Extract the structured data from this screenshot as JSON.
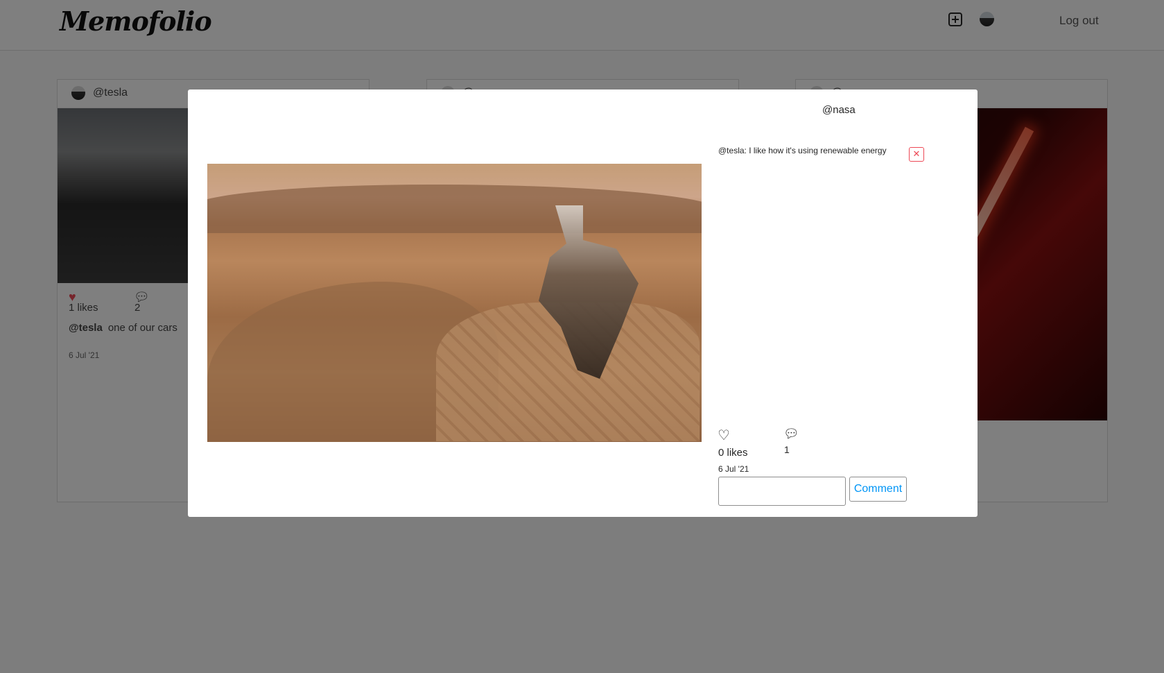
{
  "header": {
    "logo": "Memofolio",
    "logout_label": "Log out",
    "icons": {
      "add": "plus-square-icon",
      "profile": "avatar"
    }
  },
  "feed": [
    {
      "username": "@tesla",
      "likes": "1 likes",
      "comments": "2",
      "caption_user": "@tesla",
      "caption_text": "one of our cars",
      "date": "6 Jul '21",
      "liked": true
    },
    {
      "username": "@"
    },
    {
      "username": "@"
    }
  ],
  "modal": {
    "username": "@nasa",
    "comments": [
      {
        "text": "@tesla: I like how it's using renewable energy"
      }
    ],
    "likes": "0 likes",
    "comment_count": "1",
    "date": "6 Jul '21",
    "comment_input_value": "",
    "comment_button_label": "Comment",
    "delete_icon": "close-icon"
  },
  "colors": {
    "like_red": "#ed4956",
    "link_blue": "#0095f6",
    "overlay": "rgba(0,0,0,0.5)"
  }
}
